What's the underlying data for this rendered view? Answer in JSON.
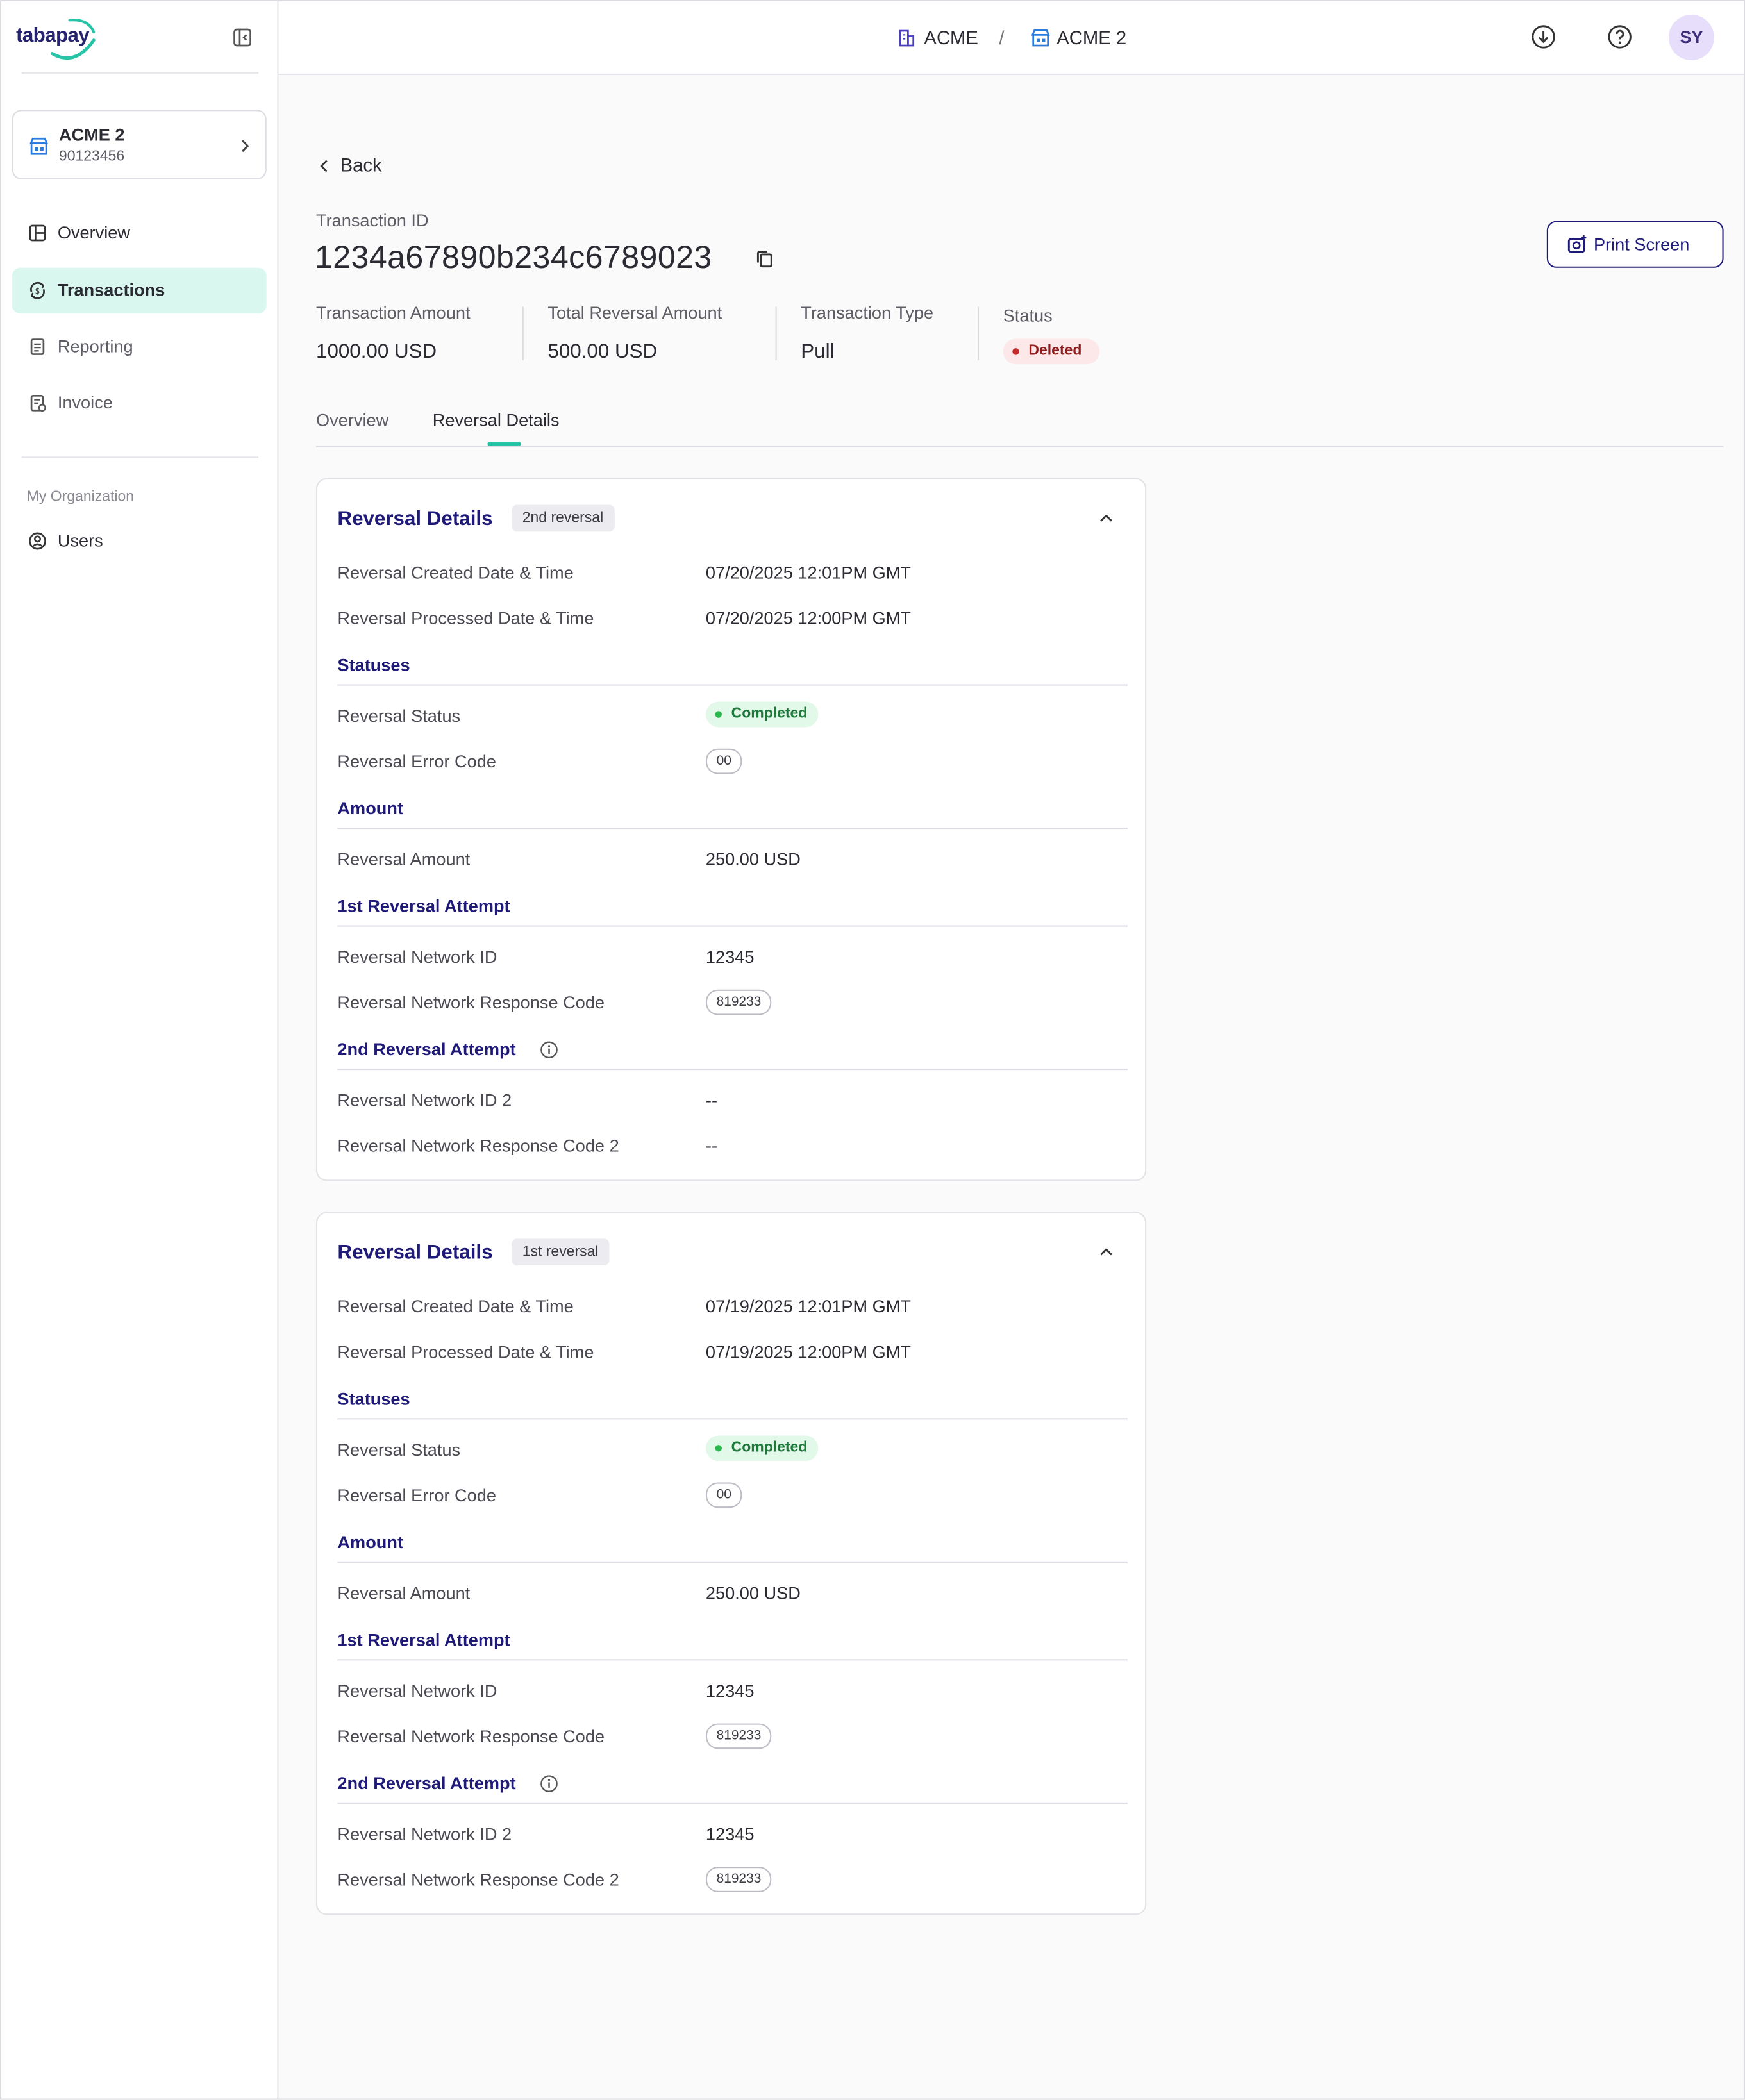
{
  "brand": {
    "logo_text": "tabapay"
  },
  "org": {
    "name": "ACME 2",
    "id": "90123456"
  },
  "nav": [
    {
      "label": "Overview",
      "icon": "layout-icon",
      "active": false
    },
    {
      "label": "Transactions",
      "icon": "exchange-icon",
      "active": true
    },
    {
      "label": "Reporting",
      "icon": "document-icon",
      "active": false
    },
    {
      "label": "Invoice",
      "icon": "invoice-icon",
      "active": false
    }
  ],
  "org_section": {
    "label": "My Organization",
    "users_label": "Users"
  },
  "breadcrumb": {
    "parent": "ACME",
    "separator": "/",
    "current": "ACME 2"
  },
  "user": {
    "initials": "SY"
  },
  "page": {
    "back_label": "Back",
    "transaction_id_label": "Transaction ID",
    "transaction_id": "1234a67890b234c6789023",
    "print_label": "Print Screen"
  },
  "summary": {
    "amount_label": "Transaction Amount",
    "amount": "1000.00 USD",
    "total_reversal_label": "Total Reversal Amount",
    "total_reversal": "500.00 USD",
    "type_label": "Transaction Type",
    "type": "Pull",
    "status_label": "Status",
    "status": "Deleted"
  },
  "tabs": [
    {
      "label": "Overview",
      "active": false
    },
    {
      "label": "Reversal Details",
      "active": true
    }
  ],
  "labels": {
    "card_title": "Reversal Details",
    "created": "Reversal Created Date & Time",
    "processed": "Reversal Processed Date & Time",
    "statuses": "Statuses",
    "reversal_status": "Reversal Status",
    "error_code": "Reversal Error Code",
    "amount": "Amount",
    "reversal_amount": "Reversal Amount",
    "attempt1": "1st Reversal Attempt",
    "network_id": "Reversal Network ID",
    "response_code": "Reversal Network Response Code",
    "attempt2": "2nd Reversal Attempt",
    "network_id2": "Reversal Network ID 2",
    "response_code2": "Reversal Network Response Code 2"
  },
  "reversals": [
    {
      "tag": "2nd reversal",
      "created": "07/20/2025 12:01PM GMT",
      "processed": "07/20/2025 12:00PM GMT",
      "status": "Completed",
      "error_code": "00",
      "amount": "250.00 USD",
      "network_id": "12345",
      "response_code": "819233",
      "network_id2": "--",
      "response_code2": "--"
    },
    {
      "tag": "1st reversal",
      "created": "07/19/2025 12:01PM GMT",
      "processed": "07/19/2025 12:00PM GMT",
      "status": "Completed",
      "error_code": "00",
      "amount": "250.00 USD",
      "network_id": "12345",
      "response_code": "819233",
      "network_id2": "12345",
      "response_code2": "819233"
    }
  ],
  "colors": {
    "accent": "#1f1a78",
    "teal": "#27c3a6",
    "active_nav": "#d9f7ef",
    "deleted": "#c42b2b",
    "completed": "#2bb84f"
  }
}
